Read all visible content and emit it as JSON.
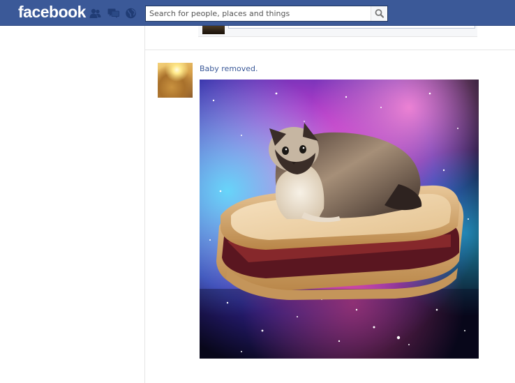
{
  "header": {
    "logo_text": "facebook",
    "jewels": [
      {
        "icon": "friend-requests-icon"
      },
      {
        "icon": "messages-icon"
      },
      {
        "icon": "notifications-globe-icon"
      }
    ],
    "search": {
      "placeholder": "Search for people, places and things",
      "value": "",
      "button_icon": "search-icon"
    }
  },
  "feed": {
    "story": {
      "text": "Baby removed.",
      "avatar_icon": "profile-picture",
      "photo": "cat-on-sandwich-in-space-image"
    }
  },
  "colors": {
    "brand_blue": "#3b5998",
    "link_blue": "#3b5998"
  }
}
